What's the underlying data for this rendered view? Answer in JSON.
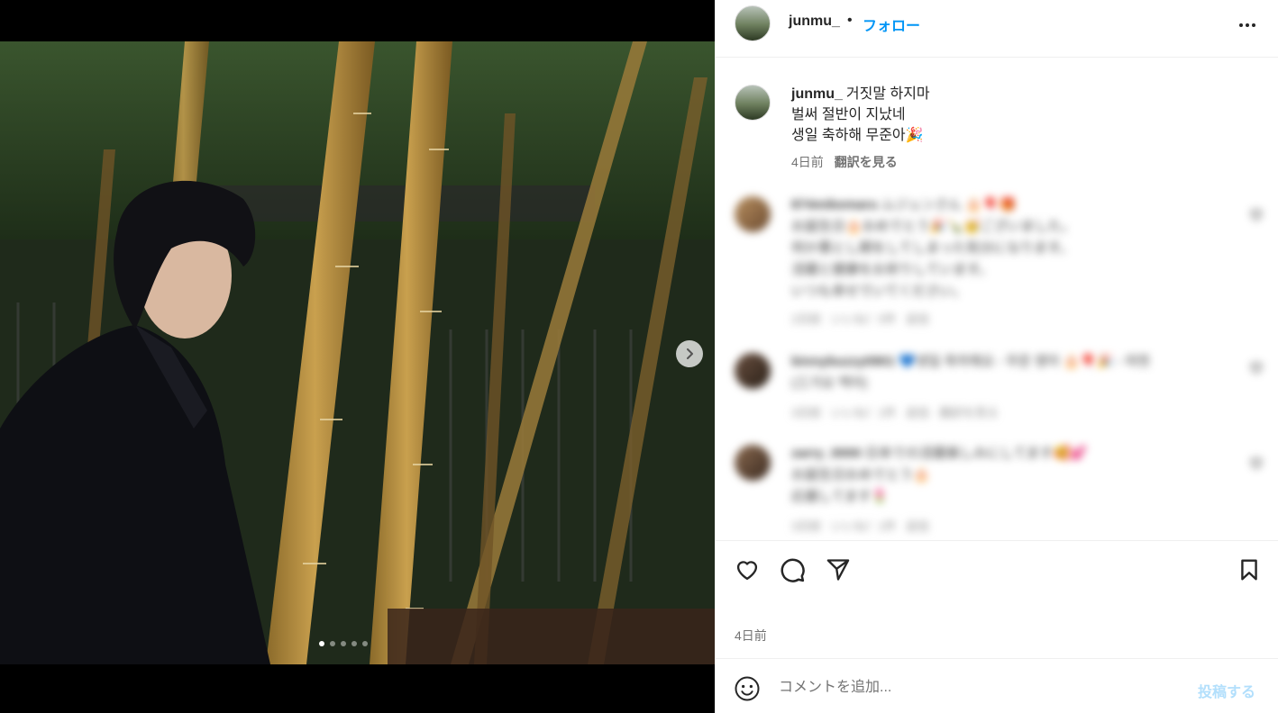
{
  "header": {
    "username": "junmu_",
    "separator": "•",
    "follow_label": "フォロー",
    "more_icon": "more-horizontal-icon"
  },
  "media": {
    "current_slide": 1,
    "total_slides": 5,
    "next_icon": "chevron-right-icon"
  },
  "caption": {
    "username": "junmu_",
    "lines": [
      "거짓말 하지마",
      "벌써 절반이 지났네",
      "생일 축하해 무준아🎉"
    ],
    "time": "4日前",
    "translate_label": "翻訳を見る"
  },
  "comments": [
    {
      "username": "874mikemaru",
      "lines": [
        "ムジュンさん 🎂🎈🎁",
        "お誕生日🎂おめでとう🎉🍾🥳ございました。",
        "何か悪とし期をしてしまった気分になります。",
        "活躍と健康をお祈りしています。",
        "いつも幸せでいてください。"
      ],
      "meta": [
        "2日前",
        "いいね！5件",
        "返信"
      ]
    },
    {
      "username": "binnybuzzy0901",
      "lines": [
        "💙생일 축하해요 - 무준 영아 🎂🎈🎉 - 따뜻",
        "(三가요 액어)"
      ],
      "meta": [
        "3日前",
        "いいね！1件",
        "返信 · 翻訳を見る"
      ]
    },
    {
      "username": "zarry_0000",
      "lines": [
        "日本での活躍楽しみにしてます🥰💕",
        "お誕生日おめでとう🎂",
        "応援してます🌷"
      ],
      "meta": [
        "3日前",
        "いいね！1件",
        "返信"
      ]
    }
  ],
  "actions": {
    "like_icon": "heart-icon",
    "comment_icon": "comment-icon",
    "share_icon": "share-icon",
    "save_icon": "bookmark-icon"
  },
  "post_time": "4日前",
  "composer": {
    "emoji_icon": "smiley-icon",
    "placeholder": "コメントを追加...",
    "post_label": "投稿する"
  },
  "colors": {
    "accent": "#0095f6",
    "post_disabled": "#b2dffc",
    "muted": "#737373",
    "border": "#efefef"
  }
}
